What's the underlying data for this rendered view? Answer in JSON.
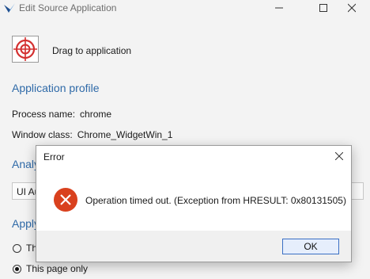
{
  "window": {
    "title": "Edit Source Application",
    "drag_label": "Drag to application"
  },
  "profile": {
    "heading": "Application profile",
    "process_label": "Process name:",
    "process_value": "chrome",
    "class_label": "Window class:",
    "class_value": "Chrome_WidgetWin_1"
  },
  "analyze": {
    "heading": "Analy",
    "combo_value": "UI Au"
  },
  "apply": {
    "heading": "Apply",
    "options": [
      {
        "label": "Th",
        "checked": false
      },
      {
        "label": "This page only",
        "checked": true
      }
    ]
  },
  "dialog": {
    "title": "Error",
    "message": "Operation timed out. (Exception from HRESULT: 0x80131505)",
    "ok_label": "OK"
  },
  "colors": {
    "heading": "#2f6aa8",
    "error_icon": "#d9411e",
    "target_red": "#d32f2f"
  }
}
